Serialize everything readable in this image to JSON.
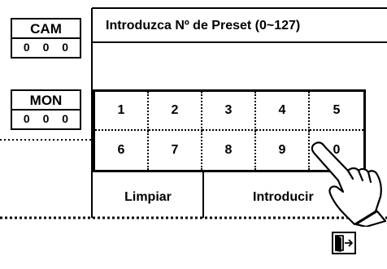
{
  "cam": {
    "label": "CAM",
    "value": "0 0 0"
  },
  "mon": {
    "label": "MON",
    "value": "0 0 0"
  },
  "title": "Introduzca Nº de Preset (0~127)",
  "keypad": {
    "row1": [
      "1",
      "2",
      "3",
      "4",
      "5"
    ],
    "row2": [
      "6",
      "7",
      "8",
      "9",
      "0"
    ]
  },
  "actions": {
    "clear": "Limpiar",
    "enter": "Introducir"
  },
  "icons": {
    "exit": "exit-door-icon",
    "pointer": "pointing-hand-icon"
  }
}
